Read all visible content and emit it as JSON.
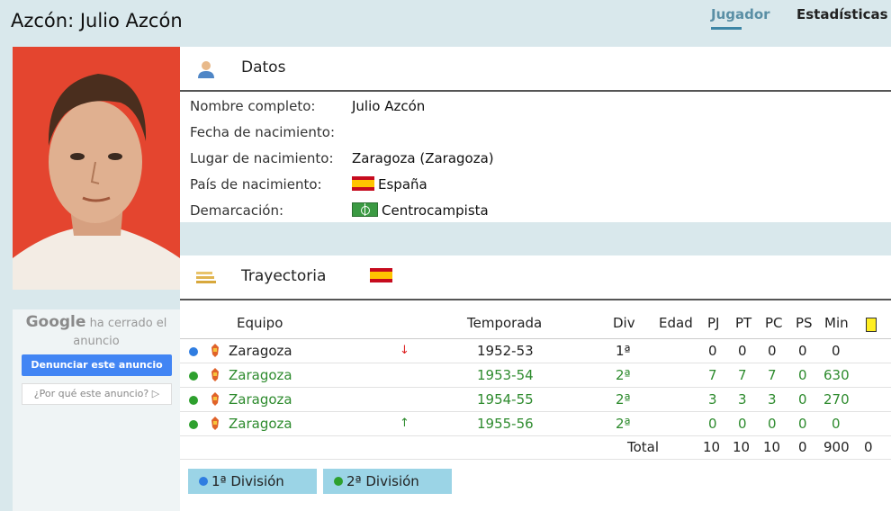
{
  "header": {
    "title": "Azcón: Julio Azcón",
    "tabs": [
      {
        "label": "Jugador",
        "active": true
      },
      {
        "label": "Estadísticas",
        "active": false
      }
    ]
  },
  "ad": {
    "google": "Google",
    "closed_text": "ha cerrado el anuncio",
    "report_button": "Denunciar este anuncio",
    "why_button": "¿Por qué este anuncio? ▷"
  },
  "datos": {
    "title": "Datos",
    "rows": [
      {
        "label": "Nombre completo:",
        "value": "Julio Azcón"
      },
      {
        "label": "Fecha de nacimiento:",
        "value": ""
      },
      {
        "label": "Lugar de nacimiento:",
        "value": "Zaragoza (Zaragoza)"
      },
      {
        "label": "País de nacimiento:",
        "value": "España"
      },
      {
        "label": "Demarcación:",
        "value": "Centrocampista"
      }
    ]
  },
  "trayectoria": {
    "title": "Trayectoria",
    "columns": [
      "Equipo",
      "Temporada",
      "Div",
      "Edad",
      "PJ",
      "PT",
      "PC",
      "PS",
      "Min"
    ],
    "rows": [
      {
        "team": "Zaragoza",
        "season": "1952-53",
        "div": "1ª",
        "pj": "0",
        "pt": "0",
        "pc": "0",
        "ps": "0",
        "min": "0",
        "arrow": "↓",
        "dot": "#2f7de1"
      },
      {
        "team": "Zaragoza",
        "season": "1953-54",
        "div": "2ª",
        "pj": "7",
        "pt": "7",
        "pc": "7",
        "ps": "0",
        "min": "630",
        "arrow": "",
        "dot": "#2ea02e"
      },
      {
        "team": "Zaragoza",
        "season": "1954-55",
        "div": "2ª",
        "pj": "3",
        "pt": "3",
        "pc": "3",
        "ps": "0",
        "min": "270",
        "arrow": "",
        "dot": "#2ea02e"
      },
      {
        "team": "Zaragoza",
        "season": "1955-56",
        "div": "2ª",
        "pj": "0",
        "pt": "0",
        "pc": "0",
        "ps": "0",
        "min": "0",
        "arrow": "↑",
        "dot": "#2ea02e"
      }
    ],
    "total": {
      "label": "Total",
      "pj": "10",
      "pt": "10",
      "pc": "10",
      "ps": "0",
      "min": "900",
      "cards": "0"
    },
    "legend": [
      {
        "label": "1ª División",
        "color": "#2f7de1"
      },
      {
        "label": "2ª División",
        "color": "#2ea02e"
      }
    ]
  }
}
